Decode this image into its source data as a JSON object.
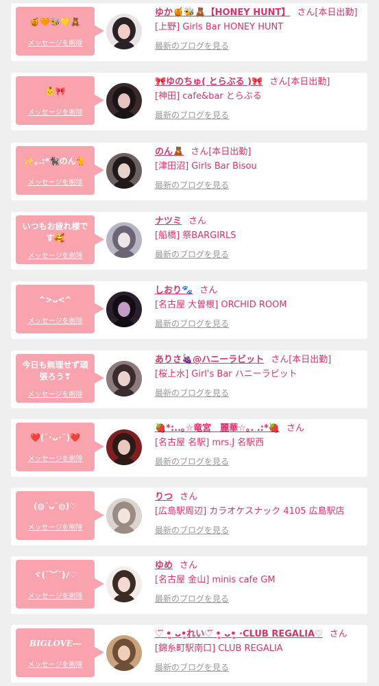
{
  "cards": [
    {
      "message": "🍯🧡🐝💛🧸",
      "delete_label": "メッセージを削除",
      "name": "ゆか🍯🐝🧸【HONEY HUNT】",
      "suffix": "さん[本日出勤]",
      "shop": "[上野] Girls Bar HONEY HUNT",
      "blog_link": "最新のブログを見る",
      "avatar_colors": [
        "#e9e3e6",
        "#2b2225",
        "#f1cfc6"
      ]
    },
    {
      "message": "👶🎀",
      "delete_label": "メッセージを削除",
      "name": "🎀ゆのちゅ( とらぶる )🎀",
      "suffix": "さん[本日出勤]",
      "shop": "[神田] cafe&bar とらぶる",
      "blog_link": "最新のブログを見る",
      "avatar_colors": [
        "#3a2a2c",
        "#1a1416",
        "#e6c3bf"
      ]
    },
    {
      "message": "✨｡.:*🐈‍⬛のん🐈",
      "delete_label": "メッセージを削除",
      "name": "のん🧸",
      "suffix": "さん[本日出勤]",
      "shop": "[津田沼] Girls Bar Bisou",
      "blog_link": "最新のブログを見る",
      "avatar_colors": [
        "#6d6060",
        "#221a1a",
        "#e8d3cc"
      ]
    },
    {
      "message": "いつもお疲れ様です🥰",
      "delete_label": "メッセージを削除",
      "name": "ナツミ",
      "suffix": "さん",
      "shop": "[船橋] 祭BARGIRLS",
      "blog_link": "最新のブログを見る",
      "avatar_colors": [
        "#b9b4c4",
        "#6b6576",
        "#efe6ea"
      ]
    },
    {
      "message": "^>ᴗ<^",
      "delete_label": "メッセージを削除",
      "name": "しおり🐾",
      "suffix": "さん",
      "shop": "[名古屋 大曽根] ORCHID ROOM",
      "blog_link": "最新のブログを見る",
      "avatar_colors": [
        "#2a1f2c",
        "#120c14",
        "#c29cc4"
      ]
    },
    {
      "message": "今日も無理せず頑張ろう❣",
      "delete_label": "メッセージを削除",
      "name": "ありさ🍇@ハニーラビット",
      "suffix": "さん[本日出勤]",
      "shop": "[桜上水] Girl's Bar ハニーラビット",
      "blog_link": "最新のブログを見る",
      "avatar_colors": [
        "#8d7a7c",
        "#3a2c2e",
        "#ecd2cd"
      ]
    },
    {
      "message": "❤️(˘･ᴗ･˘)❤️",
      "delete_label": "メッセージを削除",
      "name": "🍓*:..｡☆竜宮　麗華☆｡. .:*🍓",
      "suffix": "さん",
      "shop": "[名古屋 名駅] mrs.J 名駅西",
      "blog_link": "最新のブログを見る",
      "avatar_colors": [
        "#7e1f22",
        "#2d1a16",
        "#e9c8be"
      ]
    },
    {
      "message": "(◍˘ᴗ˘◍)♡",
      "delete_label": "メッセージを削除",
      "name": "りつ",
      "suffix": "さん",
      "shop": "[広島駅周辺] カラオケスナック 4105 広島駅店",
      "blog_link": "最新のブログを見る",
      "avatar_colors": [
        "#dcd5cf",
        "#9a8c84",
        "#f3e4dd"
      ]
    },
    {
      "message": "ヾ(˘︶˘)ﾉ♡",
      "delete_label": "メッセージを削除",
      "name": "ゆめ",
      "suffix": "さん",
      "shop": "[名古屋 金山] minis cafe GM",
      "blog_link": "最新のブログを見る",
      "avatar_colors": [
        "#f2ecea",
        "#3b2b25",
        "#f4d9d2"
      ]
    },
    {
      "message": "BIGLOVE―",
      "delete_label": "メッセージを削除",
      "name": "♡⃛ •͈ ᴗ•͈れい♡⃛ •͈ ᴗ•͈ ·CLUB REGALIA♡",
      "suffix": "さん",
      "shop": "[錦糸町駅南口] CLUB REGALIA",
      "blog_link": "最新のブログを見る",
      "avatar_colors": [
        "#c9a37e",
        "#6e4f36",
        "#edcfba"
      ]
    }
  ]
}
